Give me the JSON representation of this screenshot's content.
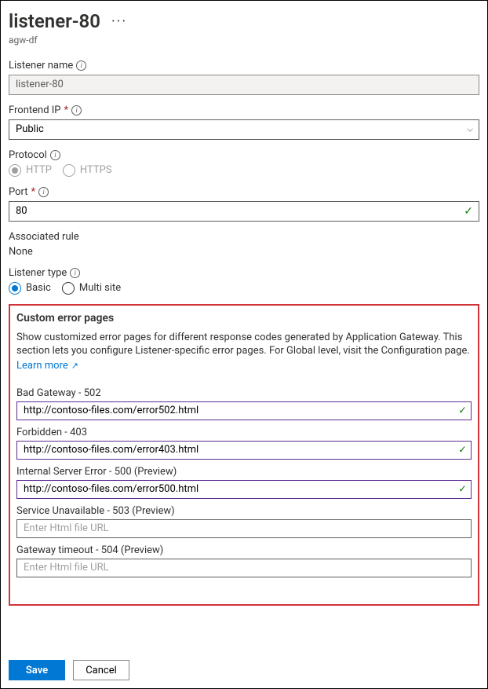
{
  "header": {
    "title": "listener-80",
    "subtitle": "agw-df"
  },
  "fields": {
    "listener_name": {
      "label": "Listener name",
      "value": "listener-80"
    },
    "frontend_ip": {
      "label": "Frontend IP",
      "value": "Public"
    },
    "protocol": {
      "label": "Protocol",
      "options": {
        "http": "HTTP",
        "https": "HTTPS"
      }
    },
    "port": {
      "label": "Port",
      "value": "80"
    },
    "associated_rule": {
      "label": "Associated rule",
      "value": "None"
    },
    "listener_type": {
      "label": "Listener type",
      "options": {
        "basic": "Basic",
        "multi": "Multi site"
      }
    }
  },
  "custom_errors": {
    "title": "Custom error pages",
    "description": "Show customized error pages for different response codes generated by Application Gateway. This section lets you configure Listener-specific error pages. For Global level, visit the Configuration page.",
    "learn_more": "Learn more",
    "items": [
      {
        "label": "Bad Gateway - 502",
        "value": "http://contoso-files.com/error502.html",
        "valid": true
      },
      {
        "label": "Forbidden - 403",
        "value": "http://contoso-files.com/error403.html",
        "valid": true
      },
      {
        "label": "Internal Server Error - 500 (Preview)",
        "value": "http://contoso-files.com/error500.html",
        "valid": true
      },
      {
        "label": "Service Unavailable - 503 (Preview)",
        "value": "",
        "placeholder": "Enter Html file URL",
        "valid": false
      },
      {
        "label": "Gateway timeout - 504 (Preview)",
        "value": "",
        "placeholder": "Enter Html file URL",
        "valid": false
      }
    ]
  },
  "footer": {
    "save": "Save",
    "cancel": "Cancel"
  }
}
